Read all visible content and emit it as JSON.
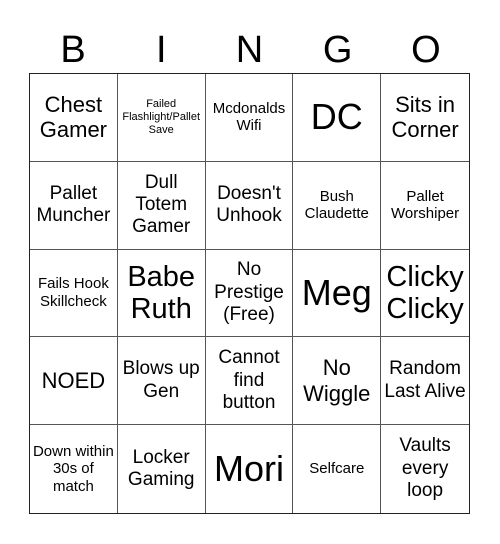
{
  "header": {
    "letters": [
      "B",
      "I",
      "N",
      "G",
      "O"
    ]
  },
  "board": {
    "cells": [
      [
        "Chest Gamer",
        "Failed Flashlight/Pallet Save",
        "Mcdonalds Wifi",
        "DC",
        "Sits in Corner"
      ],
      [
        "Pallet Muncher",
        "Dull Totem Gamer",
        "Doesn't Unhook",
        "Bush Claudette",
        "Pallet Worshiper"
      ],
      [
        "Fails Hook Skillcheck",
        "Babe Ruth",
        "No Prestige (Free)",
        "Meg",
        "Clicky Clicky"
      ],
      [
        "NOED",
        "Blows up Gen",
        "Cannot find button",
        "No Wiggle",
        "Random Last Alive"
      ],
      [
        "Down within 30s of match",
        "Locker Gaming",
        "Mori",
        "Selfcare",
        "Vaults every loop"
      ]
    ]
  }
}
